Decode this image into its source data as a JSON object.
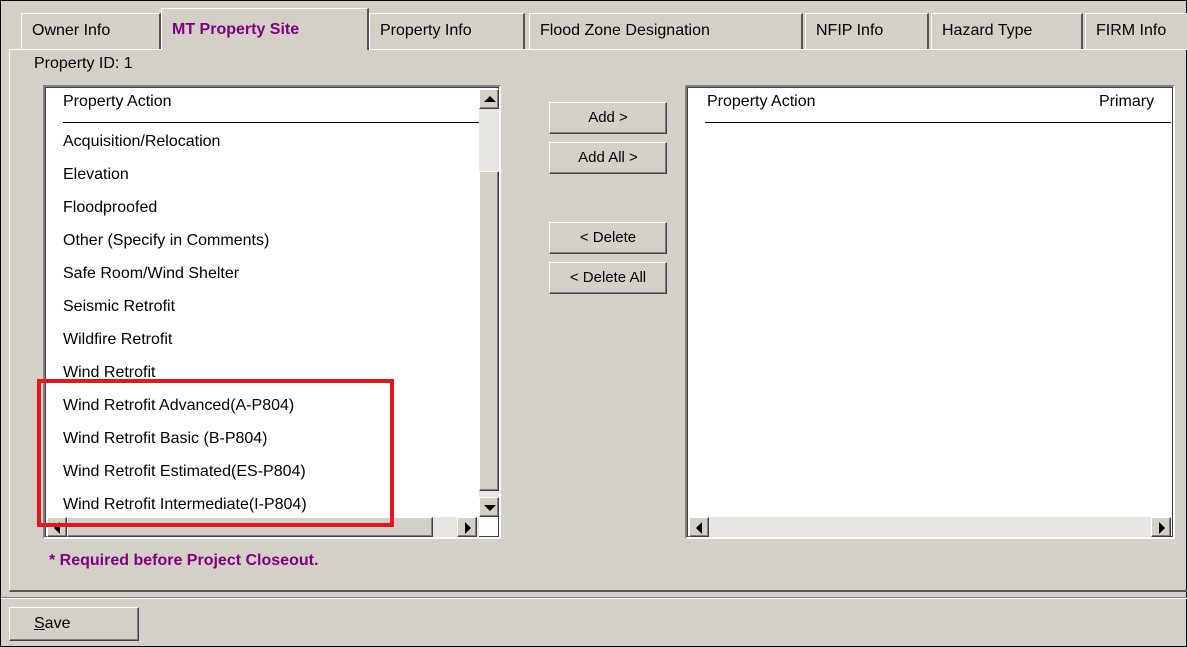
{
  "tabs": [
    {
      "label": "Owner Info"
    },
    {
      "label": "MT Property Site"
    },
    {
      "label": "Property Info"
    },
    {
      "label": "Flood Zone Designation"
    },
    {
      "label": "NFIP Info"
    },
    {
      "label": "Hazard Type"
    },
    {
      "label": "FIRM Info"
    }
  ],
  "property_id": "Property ID:  1",
  "available_list": {
    "header": "Property Action",
    "items": [
      "Acquisition/Relocation",
      "Elevation",
      "Floodproofed",
      "Other (Specify in Comments)",
      "Safe Room/Wind Shelter",
      "Seismic Retrofit",
      "Wildfire Retrofit",
      "Wind Retrofit",
      "Wind Retrofit Advanced(A-P804)",
      "Wind Retrofit Basic (B-P804)",
      "Wind Retrofit Estimated(ES-P804)",
      "Wind Retrofit Intermediate(I-P804)"
    ]
  },
  "buttons": {
    "add": "Add >",
    "add_all": "Add All >",
    "delete": "< Delete",
    "delete_all": "< Delete All",
    "save_prefix": "",
    "save_underlined": "S",
    "save_rest": "ave"
  },
  "selected_list": {
    "header_action": "Property Action",
    "header_primary": "Primary"
  },
  "required_note": "* Required before Project Closeout.",
  "colors": {
    "accent_text": "#800080",
    "highlight_box": "#e8141c",
    "window_bg": "#d4d0c8"
  },
  "icons": {
    "scroll_up": "triangle-up",
    "scroll_down": "triangle-down",
    "scroll_left": "triangle-left",
    "scroll_right": "triangle-right"
  }
}
